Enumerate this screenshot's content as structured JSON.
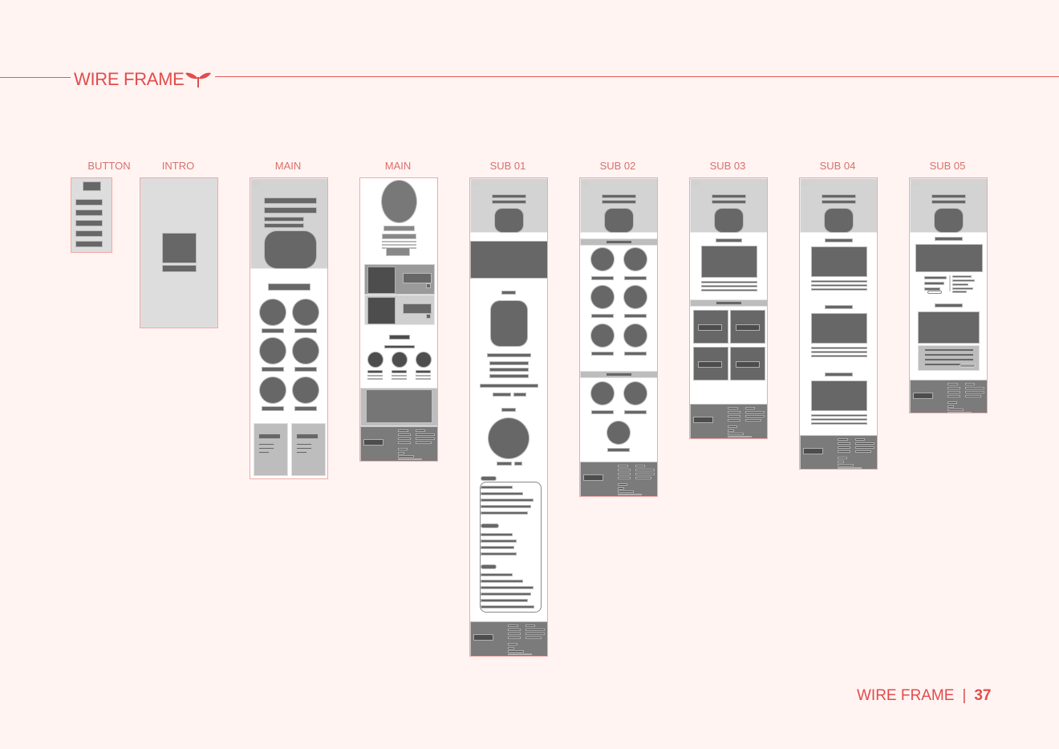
{
  "header": {
    "title": "WIRE FRAME",
    "logo_icon": "sprout-icon"
  },
  "colors": {
    "accent": "#e24c4c",
    "frame_border": "#f2a9a6",
    "block_dark": "#666766",
    "block_light": "#d3d3d3"
  },
  "frames": [
    {
      "label": "BUTTON"
    },
    {
      "label": "INTRO"
    },
    {
      "label": "MAIN"
    },
    {
      "label": "MAIN"
    },
    {
      "label": "SUB 01"
    },
    {
      "label": "SUB 02"
    },
    {
      "label": "SUB 03"
    },
    {
      "label": "SUB 04"
    },
    {
      "label": "SUB 05"
    }
  ],
  "footer": {
    "section": "WIRE FRAME",
    "separator": "|",
    "page_number": "37"
  }
}
